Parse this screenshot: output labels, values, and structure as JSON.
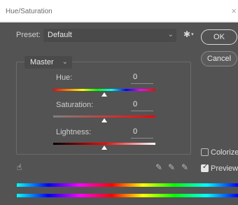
{
  "window": {
    "title": "Hue/Saturation",
    "close_glyph": "×"
  },
  "preset": {
    "label": "Preset:",
    "value": "Default"
  },
  "buttons": {
    "ok": "OK",
    "cancel": "Cancel"
  },
  "channel": {
    "value": "Master"
  },
  "sliders": {
    "hue": {
      "label": "Hue:",
      "value": "0",
      "position": 0.5
    },
    "saturation": {
      "label": "Saturation:",
      "value": "0",
      "position": 0.5
    },
    "lightness": {
      "label": "Lightness:",
      "value": "0",
      "position": 0.5
    }
  },
  "options": {
    "colorize": {
      "label": "Colorize",
      "checked": false
    },
    "preview": {
      "label": "Preview",
      "checked": true
    }
  },
  "icons": {
    "hand": "hand-adjust-icon",
    "eyedroppers": [
      "eyedropper-icon",
      "eyedropper-plus-icon",
      "eyedropper-minus-icon"
    ],
    "settings": "gear-icon"
  },
  "colors": {
    "dialog_bg": "#535353",
    "field_bg": "#4a4a4a",
    "accent_text": "#e8e8e8"
  }
}
